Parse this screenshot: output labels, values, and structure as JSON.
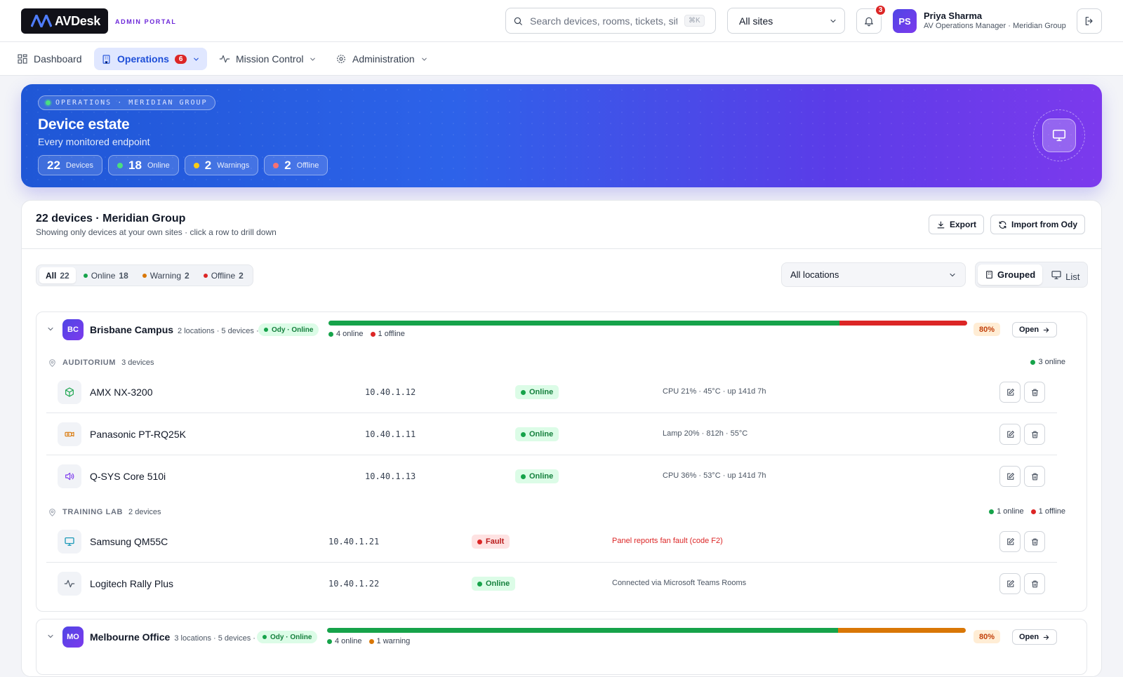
{
  "app": {
    "logo_text": "AVDesk",
    "portal_label": "ADMIN PORTAL",
    "search_placeholder": "Search devices, rooms, tickets, sit",
    "search_shortcut": "⌘K",
    "site_filter": "All sites",
    "notifications_count": "3",
    "user": {
      "initials": "PS",
      "name": "Priya Sharma",
      "role": "AV Operations Manager · Meridian Group"
    }
  },
  "nav": {
    "dashboard": "Dashboard",
    "operations": "Operations",
    "operations_badge": "6",
    "mission_control": "Mission Control",
    "administration": "Administration"
  },
  "hero": {
    "eyebrow": "OPERATIONS · MERIDIAN GROUP",
    "title": "Device estate",
    "subtitle": "Every monitored endpoint",
    "stats": [
      {
        "value": "22",
        "label": "Devices"
      },
      {
        "value": "18",
        "label": "Online",
        "color": "#4ade80"
      },
      {
        "value": "2",
        "label": "Warnings",
        "color": "#facc15"
      },
      {
        "value": "2",
        "label": "Offline",
        "color": "#f87171"
      }
    ]
  },
  "panel": {
    "title": "22 devices · Meridian Group",
    "subtitle": "Showing only devices at your own sites · click a row to drill down",
    "export_label": "Export",
    "import_label": "Import from Ody",
    "filters": [
      {
        "label": "All",
        "count": "22"
      },
      {
        "label": "Online",
        "count": "18",
        "color": "#16a34a"
      },
      {
        "label": "Warning",
        "count": "2",
        "color": "#d97706"
      },
      {
        "label": "Offline",
        "count": "2",
        "color": "#dc2626"
      }
    ],
    "location_filter": "All locations",
    "view_grouped": "Grouped",
    "view_list": "List"
  },
  "sites": [
    {
      "initials": "BC",
      "name": "Brisbane Campus",
      "meta": "2 locations · 5 devices ·",
      "ody": "Ody · Online",
      "health_online_fraction": 0.8,
      "health_secondary_color": "#dc2626",
      "legend_online": "4 online",
      "legend_secondary": "1 offline",
      "percent": "80%",
      "open_label": "Open",
      "locations": [
        {
          "name": "AUDITORIUM",
          "count": "3 devices",
          "summary_online": "3 online",
          "devices": [
            {
              "icon": "cube-icon",
              "name": "AMX NX-3200",
              "ip": "10.40.1.12",
              "status": "Online",
              "info": "CPU 21% · 45°C · up 141d 7h"
            },
            {
              "icon": "projector-icon",
              "name": "Panasonic PT-RQ25K",
              "ip": "10.40.1.11",
              "status": "Online",
              "info": "Lamp 20% · 812h · 55°C"
            },
            {
              "icon": "speaker-icon",
              "name": "Q-SYS Core 510i",
              "ip": "10.40.1.13",
              "status": "Online",
              "info": "CPU 36% · 53°C · up 141d 7h"
            }
          ]
        },
        {
          "name": "TRAINING LAB",
          "count": "2 devices",
          "summary_online": "1 online",
          "summary_offline": "1 offline",
          "devices": [
            {
              "icon": "monitor-icon",
              "name": "Samsung QM55C",
              "ip": "10.40.1.21",
              "status": "Fault",
              "info": "Panel reports fan fault (code F2)"
            },
            {
              "icon": "activity-icon",
              "name": "Logitech Rally Plus",
              "ip": "10.40.1.22",
              "status": "Online",
              "info": "Connected via Microsoft Teams Rooms"
            }
          ]
        }
      ]
    },
    {
      "initials": "MO",
      "name": "Melbourne Office",
      "meta": "3 locations · 5 devices ·",
      "ody": "Ody · Online",
      "health_online_fraction": 0.8,
      "health_secondary_color": "#d97706",
      "legend_online": "4 online",
      "legend_secondary": "1 warning",
      "percent": "80%",
      "open_label": "Open"
    }
  ],
  "colors": {
    "accent": "#4f46e5",
    "online": "#16a34a",
    "offline": "#dc2626",
    "warning": "#d97706"
  }
}
